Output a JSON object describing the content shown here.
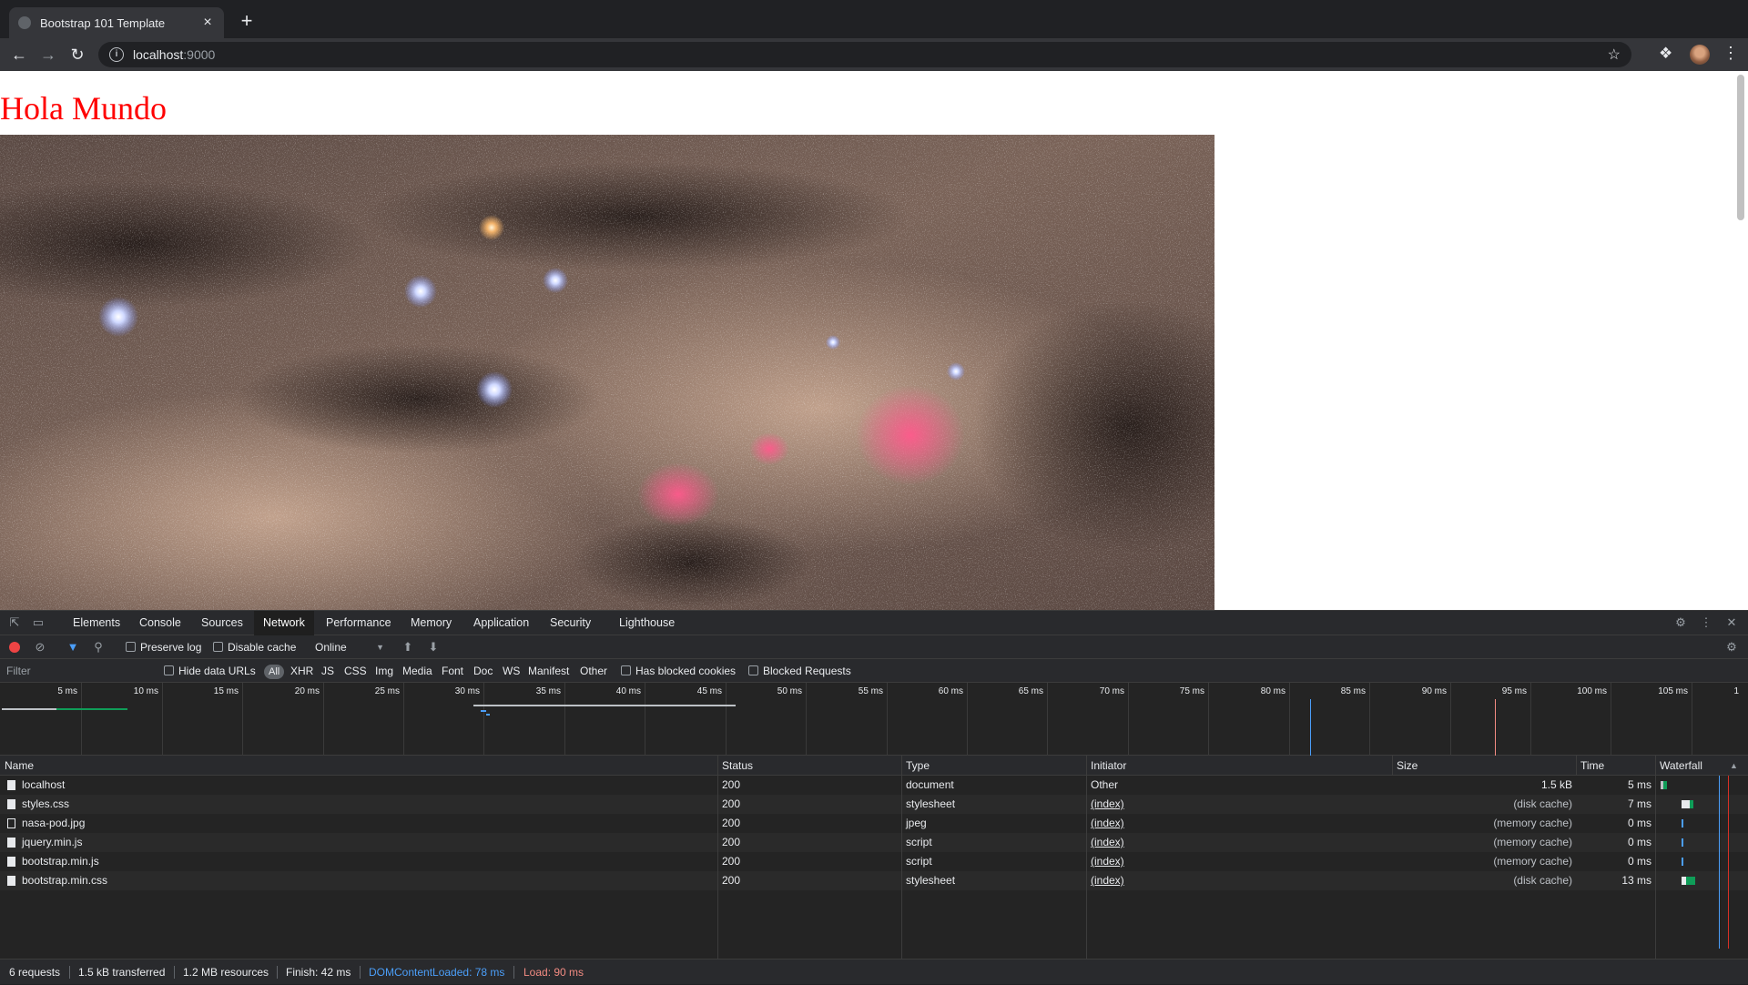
{
  "browser": {
    "tab_title": "Bootstrap 101 Template",
    "tab_close": "×",
    "new_tab": "+",
    "url_host": "localhost",
    "url_port": ":9000"
  },
  "page": {
    "heading": "Hola Mundo",
    "heading_color": "#ff0000"
  },
  "devtools": {
    "tabs": [
      "Elements",
      "Console",
      "Sources",
      "Network",
      "Performance",
      "Memory",
      "Application",
      "Security",
      "Lighthouse"
    ],
    "active_tab": "Network",
    "toolbar": {
      "preserve_log": "Preserve log",
      "disable_cache": "Disable cache",
      "throttle": "Online"
    },
    "filterbar": {
      "filter_placeholder": "Filter",
      "hide_data_urls": "Hide data URLs",
      "types": [
        "All",
        "XHR",
        "JS",
        "CSS",
        "Img",
        "Media",
        "Font",
        "Doc",
        "WS",
        "Manifest",
        "Other"
      ],
      "has_blocked_cookies": "Has blocked cookies",
      "blocked_requests": "Blocked Requests"
    },
    "overview_ticks": [
      "5 ms",
      "10 ms",
      "15 ms",
      "20 ms",
      "25 ms",
      "30 ms",
      "35 ms",
      "40 ms",
      "45 ms",
      "50 ms",
      "55 ms",
      "60 ms",
      "65 ms",
      "70 ms",
      "75 ms",
      "80 ms",
      "85 ms",
      "90 ms",
      "95 ms",
      "100 ms",
      "105 ms",
      "1"
    ],
    "columns": {
      "name": "Name",
      "status": "Status",
      "type": "Type",
      "initiator": "Initiator",
      "size": "Size",
      "time": "Time",
      "waterfall": "Waterfall"
    },
    "requests": [
      {
        "name": "localhost",
        "status": "200",
        "type": "document",
        "initiator": "Other",
        "size": "1.5 kB",
        "time": "5 ms"
      },
      {
        "name": "styles.css",
        "status": "200",
        "type": "stylesheet",
        "initiator": "(index)",
        "size": "(disk cache)",
        "time": "7 ms"
      },
      {
        "name": "nasa-pod.jpg",
        "status": "200",
        "type": "jpeg",
        "initiator": "(index)",
        "size": "(memory cache)",
        "time": "0 ms"
      },
      {
        "name": "jquery.min.js",
        "status": "200",
        "type": "script",
        "initiator": "(index)",
        "size": "(memory cache)",
        "time": "0 ms"
      },
      {
        "name": "bootstrap.min.js",
        "status": "200",
        "type": "script",
        "initiator": "(index)",
        "size": "(memory cache)",
        "time": "0 ms"
      },
      {
        "name": "bootstrap.min.css",
        "status": "200",
        "type": "stylesheet",
        "initiator": "(index)",
        "size": "(disk cache)",
        "time": "13 ms"
      }
    ],
    "summary": {
      "requests": "6 requests",
      "transferred": "1.5 kB transferred",
      "resources": "1.2 MB resources",
      "finish": "Finish: 42 ms",
      "dom_content_loaded": "DOMContentLoaded: 78 ms",
      "load": "Load: 90 ms"
    },
    "colors": {
      "dom_content_loaded": "#4b9ef8",
      "load": "#f28b82"
    }
  }
}
